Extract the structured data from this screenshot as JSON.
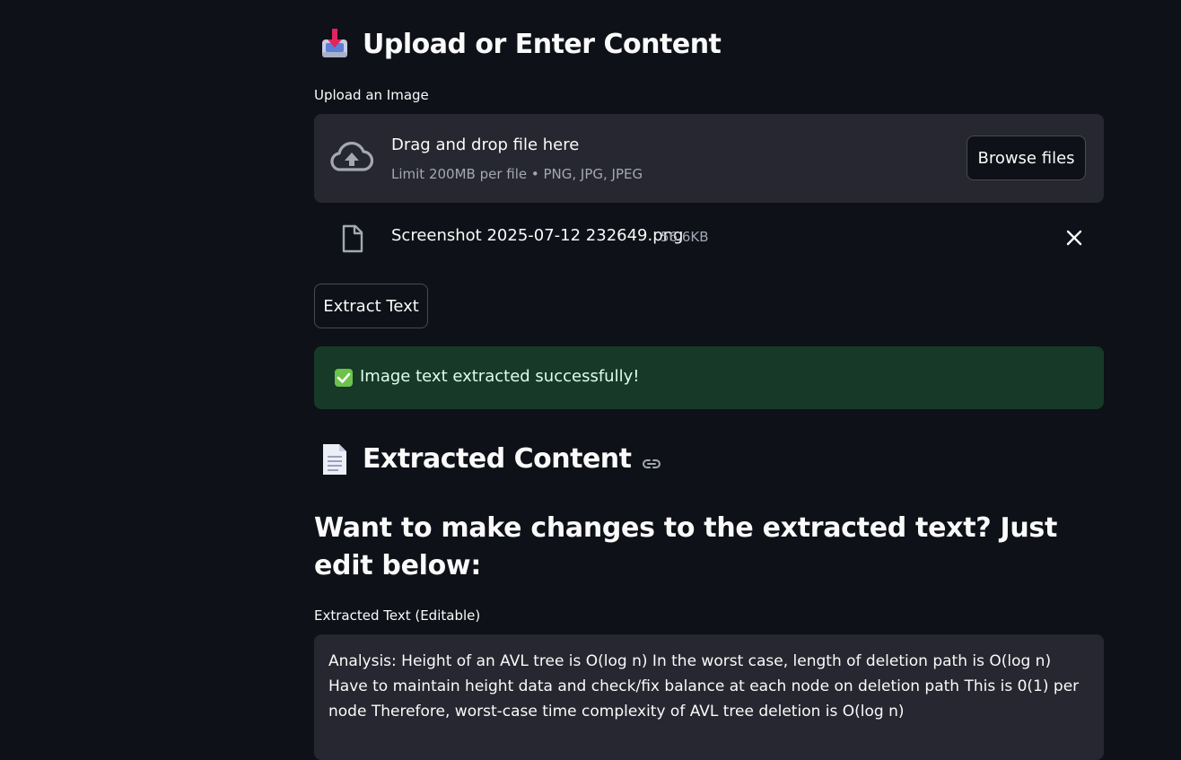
{
  "upload_section": {
    "heading": "Upload or Enter Content",
    "heading_icon": "inbox-tray-emoji",
    "upload_label": "Upload an Image",
    "dropzone_title": "Drag and drop file here",
    "dropzone_subtitle": "Limit 200MB per file • PNG, JPG, JPEG",
    "browse_button": "Browse files",
    "uploaded_file": {
      "name": "Screenshot 2025-07-12 232649.png",
      "size": "56.6KB"
    },
    "extract_button": "Extract Text",
    "success_message": "Image text extracted successfully!"
  },
  "extracted_section": {
    "heading": "Extracted Content",
    "heading_icon": "page-facing-up-emoji",
    "subheading": "Want to make changes to the extracted text? Just edit below:",
    "textarea_label": "Extracted Text (Editable)",
    "textarea_value": "Analysis: Height of an AVL tree is O(log n) In the worst case, length of deletion path is O(log n) Have to maintain height data and check/fix balance at each node on deletion path This is 0(1) per node Therefore, worst-case time complexity of AVL tree deletion is O(log n)"
  },
  "colors": {
    "background": "#0e1117",
    "panel": "#262730",
    "success_bg": "#173928",
    "text": "#fafafa",
    "muted": "#a3a8b4"
  }
}
